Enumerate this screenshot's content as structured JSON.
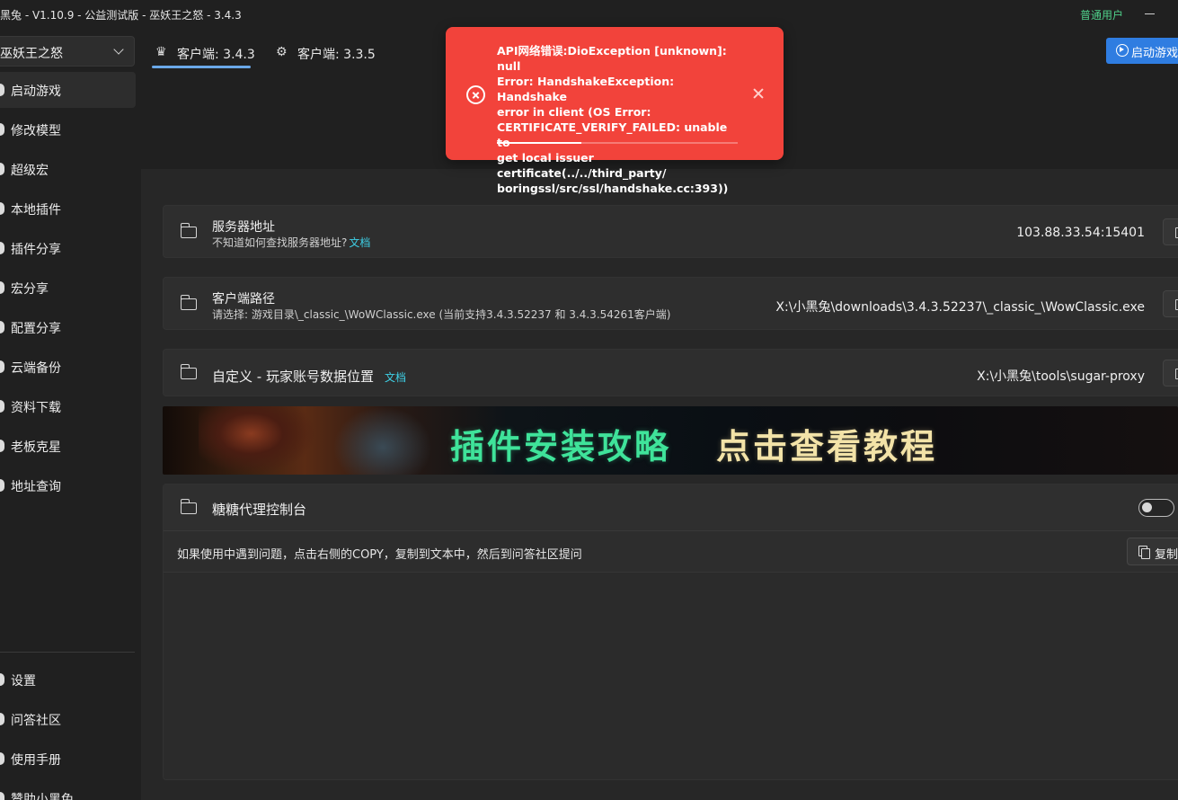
{
  "window": {
    "title": "黑兔 - V1.10.9 - 公益测试版 - 巫妖王之怒 - 3.4.3",
    "user_label": "普通用户"
  },
  "sidebar": {
    "game_select": "巫妖王之怒",
    "items": [
      {
        "label": "启动游戏",
        "active": true
      },
      {
        "label": "修改模型"
      },
      {
        "label": "超级宏"
      },
      {
        "label": "本地插件"
      },
      {
        "label": "插件分享"
      },
      {
        "label": "宏分享"
      },
      {
        "label": "配置分享"
      },
      {
        "label": "云端备份"
      },
      {
        "label": "资料下载"
      },
      {
        "label": "老板克星"
      },
      {
        "label": "地址查询"
      }
    ],
    "bottom_items": [
      {
        "label": "设置"
      },
      {
        "label": "问答社区"
      },
      {
        "label": "使用手册"
      },
      {
        "label": "赞助小黑兔"
      }
    ]
  },
  "tabs": [
    {
      "label": "客户端: 3.4.3",
      "icon": "crown-icon",
      "active": true
    },
    {
      "label": "客户端: 3.3.5",
      "icon": "gear-icon"
    }
  ],
  "launch_button": {
    "label": "启动游戏"
  },
  "toast": {
    "message": "API网络错误:DioException [unknown]: null\nError: HandshakeException: Handshake\nerror in client (OS Error:\n CERTIFICATE_VERIFY_FAILED: unable to\nget local issuer certificate(../../third_party/\nboringssl/src/ssl/handshake.cc:393))",
    "progress": 0.35,
    "color": "#f2433b"
  },
  "server": {
    "title": "服务器地址",
    "subtitle": "不知道如何查找服务器地址?",
    "link": "文档",
    "value": "103.88.33.54:15401"
  },
  "client_path": {
    "title": "客户端路径",
    "subtitle": "请选择: 游戏目录\\_classic_\\WoWClassic.exe  (当前支持3.4.3.52237 和 3.4.3.54261客户端)",
    "value": "X:\\小黑兔\\downloads\\3.4.3.52237\\_classic_\\WowClassic.exe"
  },
  "account_data": {
    "title": "自定义 - 玩家账号数据位置",
    "link": "文档",
    "value": "X:\\小黑兔\\tools\\sugar-proxy"
  },
  "banner": {
    "text1": "插件安装攻略",
    "text2": "点击查看教程"
  },
  "proxy": {
    "title": "糖糖代理控制台",
    "toggle_on": false,
    "hint": "如果使用中遇到问题，点击右侧的COPY，复制到文本中，然后到问答社区提问",
    "copy_label": "复制"
  }
}
